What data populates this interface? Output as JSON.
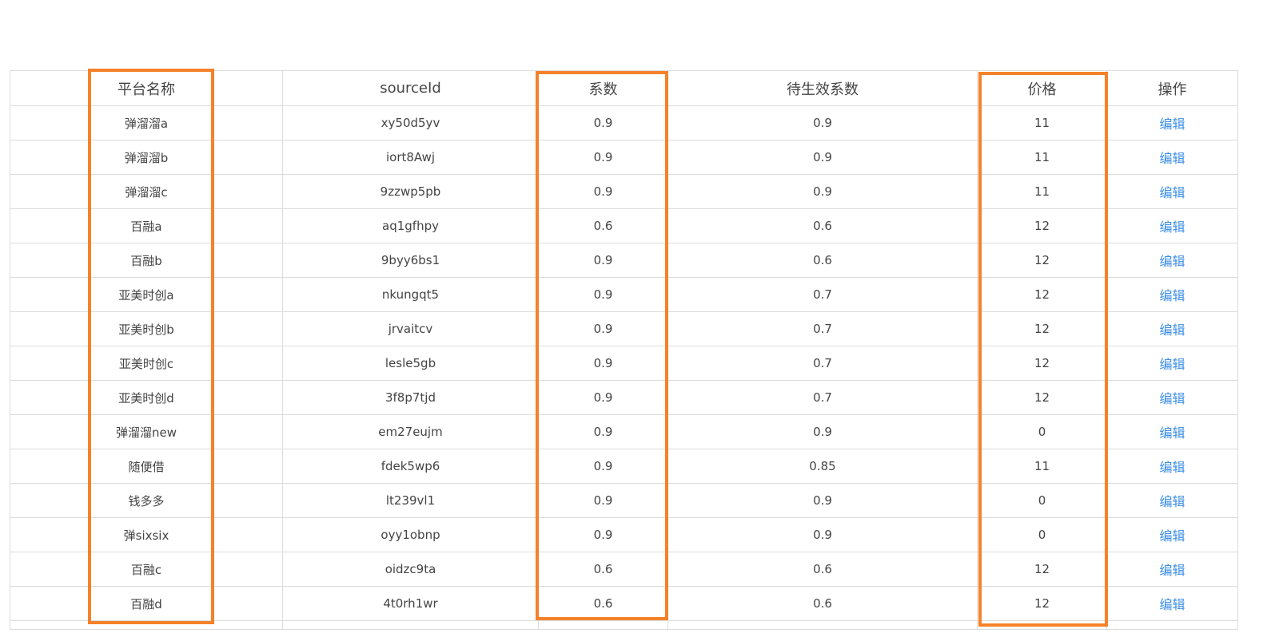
{
  "table": {
    "headers": {
      "platform": "平台名称",
      "source_id": "sourceId",
      "coefficient": "系数",
      "pending_coefficient": "待生效系数",
      "price": "价格",
      "actions": "操作"
    },
    "edit_label": "编辑",
    "rows": [
      {
        "platform": "弹溜溜a",
        "source_id": "xy50d5yv",
        "coefficient": "0.9",
        "pending": "0.9",
        "price": "11"
      },
      {
        "platform": "弹溜溜b",
        "source_id": "iort8Awj",
        "coefficient": "0.9",
        "pending": "0.9",
        "price": "11"
      },
      {
        "platform": "弹溜溜c",
        "source_id": "9zzwp5pb",
        "coefficient": "0.9",
        "pending": "0.9",
        "price": "11"
      },
      {
        "platform": "百融a",
        "source_id": "aq1gfhpy",
        "coefficient": "0.6",
        "pending": "0.6",
        "price": "12"
      },
      {
        "platform": "百融b",
        "source_id": "9byy6bs1",
        "coefficient": "0.9",
        "pending": "0.6",
        "price": "12"
      },
      {
        "platform": "亚美时创a",
        "source_id": "nkungqt5",
        "coefficient": "0.9",
        "pending": "0.7",
        "price": "12"
      },
      {
        "platform": "亚美时创b",
        "source_id": "jrvaitcv",
        "coefficient": "0.9",
        "pending": "0.7",
        "price": "12"
      },
      {
        "platform": "亚美时创c",
        "source_id": "lesle5gb",
        "coefficient": "0.9",
        "pending": "0.7",
        "price": "12"
      },
      {
        "platform": "亚美时创d",
        "source_id": "3f8p7tjd",
        "coefficient": "0.9",
        "pending": "0.7",
        "price": "12"
      },
      {
        "platform": "弹溜溜new",
        "source_id": "em27eujm",
        "coefficient": "0.9",
        "pending": "0.9",
        "price": "0"
      },
      {
        "platform": "随便借",
        "source_id": "fdek5wp6",
        "coefficient": "0.9",
        "pending": "0.85",
        "price": "11"
      },
      {
        "platform": "钱多多",
        "source_id": "lt239vl1",
        "coefficient": "0.9",
        "pending": "0.9",
        "price": "0"
      },
      {
        "platform": "弹sixsix",
        "source_id": "oyy1obnp",
        "coefficient": "0.9",
        "pending": "0.9",
        "price": "0"
      },
      {
        "platform": "百融c",
        "source_id": "oidzc9ta",
        "coefficient": "0.6",
        "pending": "0.6",
        "price": "12"
      },
      {
        "platform": "百融d",
        "source_id": "4t0rh1wr",
        "coefficient": "0.6",
        "pending": "0.6",
        "price": "12"
      }
    ]
  },
  "highlight_color": "#f5822a",
  "link_color": "#3a8ee6"
}
